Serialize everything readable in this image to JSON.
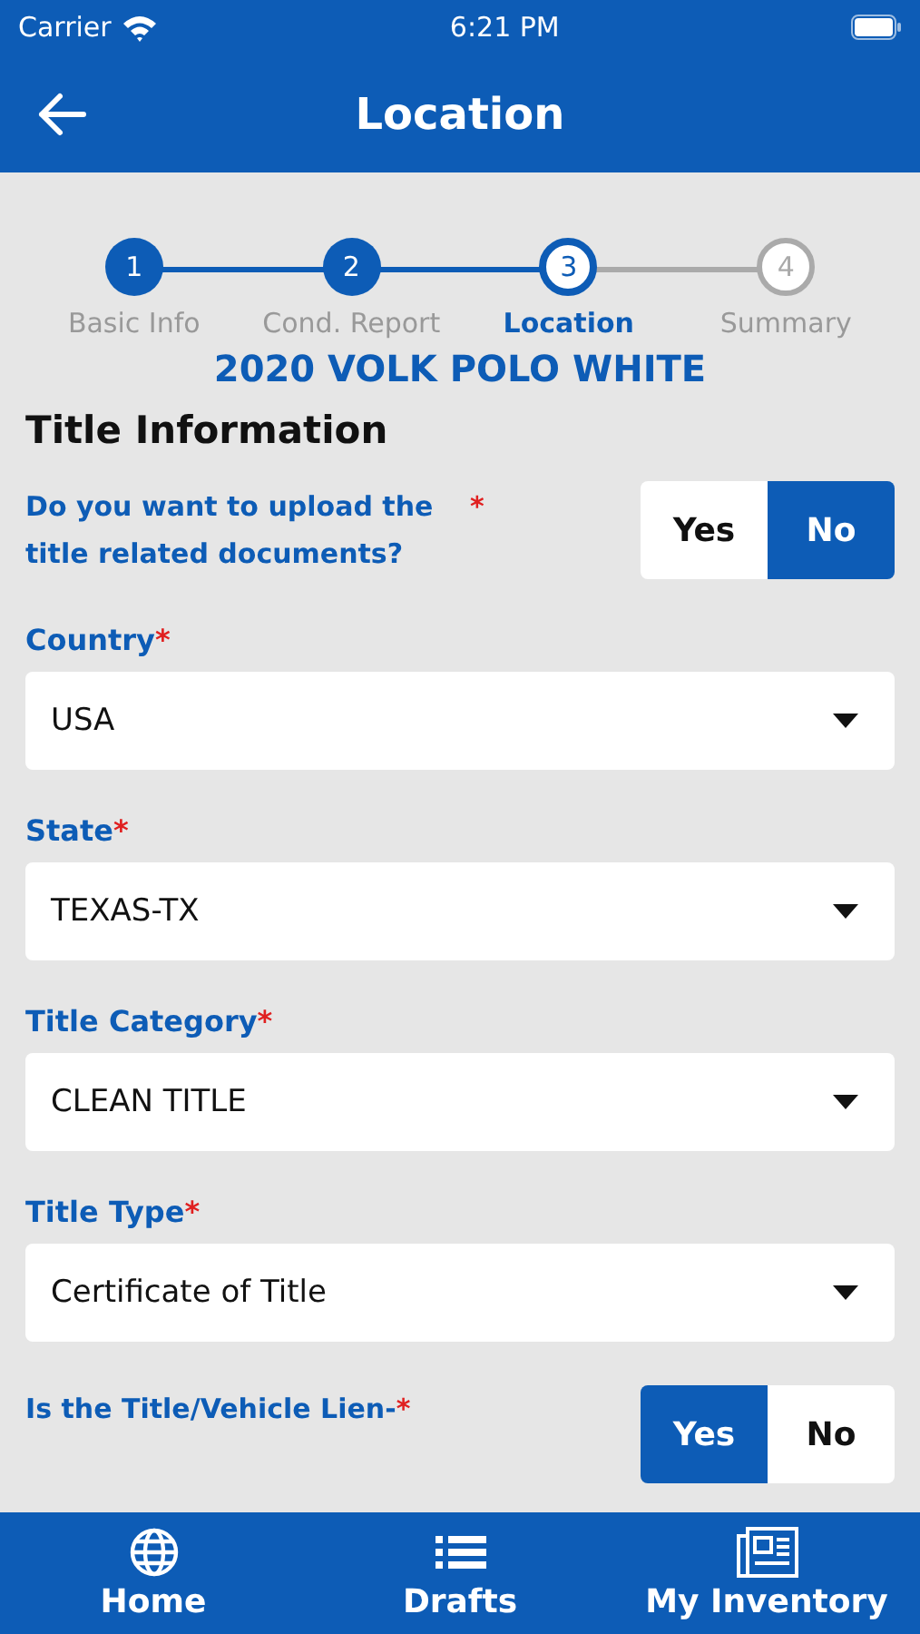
{
  "status_bar": {
    "carrier": "Carrier",
    "time": "6:21 PM"
  },
  "header": {
    "title": "Location"
  },
  "stepper": [
    {
      "number": "1",
      "label": "Basic Info",
      "completed": true,
      "selected": false
    },
    {
      "number": "2",
      "label": "Cond. Report",
      "completed": true,
      "selected": false
    },
    {
      "number": "3",
      "label": "Location",
      "completed": false,
      "selected": true
    },
    {
      "number": "4",
      "label": "Summary",
      "completed": false,
      "selected": false
    }
  ],
  "vehicle": "2020 VOLK POLO WHITE",
  "section_title": "Title Information",
  "fields": [
    {
      "kind": "toggle",
      "label": "Do you want to upload the title related documents?",
      "required_mark": "*",
      "options": [
        {
          "label": "Yes",
          "selected": false
        },
        {
          "label": "No",
          "selected": true
        }
      ]
    },
    {
      "kind": "dropdown",
      "label": "Country",
      "required_mark": "*",
      "value": "USA"
    },
    {
      "kind": "dropdown",
      "label": "State",
      "required_mark": "*",
      "value": "TEXAS-TX"
    },
    {
      "kind": "dropdown",
      "label": "Title Category",
      "required_mark": "*",
      "value": "CLEAN TITLE"
    },
    {
      "kind": "dropdown",
      "label": "Title Type",
      "required_mark": "*",
      "value": "Certificate of Title"
    },
    {
      "kind": "toggle",
      "label": "Is the Title/Vehicle Lien-",
      "required_mark": "*",
      "options": [
        {
          "label": "Yes",
          "selected": true
        },
        {
          "label": "No",
          "selected": false
        }
      ]
    }
  ],
  "tab_bar": [
    {
      "label": "Home"
    },
    {
      "label": "Drafts"
    },
    {
      "label": "My Inventory"
    }
  ]
}
